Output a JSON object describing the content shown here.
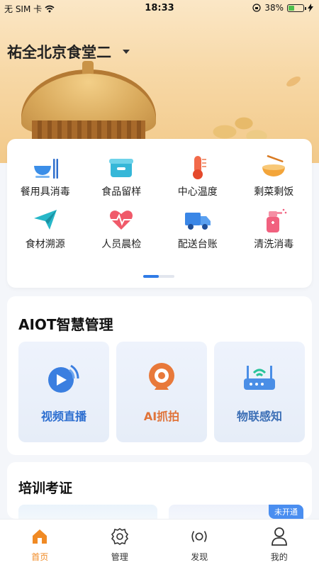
{
  "status_bar": {
    "carrier": "无 SIM 卡",
    "time": "18:33",
    "battery": "38%",
    "battery_level": 0.38
  },
  "header": {
    "canteen_name": "祐全北京食堂二"
  },
  "functions": [
    {
      "label": "餐用具消毒",
      "icon": "tableware-icon"
    },
    {
      "label": "食品留样",
      "icon": "sample-box-icon"
    },
    {
      "label": "中心温度",
      "icon": "thermometer-icon"
    },
    {
      "label": "剩菜剩饭",
      "icon": "leftover-bowl-icon"
    },
    {
      "label": "食材溯源",
      "icon": "paper-plane-icon"
    },
    {
      "label": "人员晨检",
      "icon": "heartbeat-icon"
    },
    {
      "label": "配送台账",
      "icon": "truck-icon"
    },
    {
      "label": "清洗消毒",
      "icon": "spray-bottle-icon"
    }
  ],
  "aiot": {
    "title": "AIOT智慧管理",
    "tiles": [
      {
        "label": "视频直播",
        "icon": "video-live-icon",
        "color": "#2e6fd0"
      },
      {
        "label": "AI抓拍",
        "icon": "webcam-icon",
        "color": "#e0743a"
      },
      {
        "label": "物联感知",
        "icon": "router-icon",
        "color": "#3c6fb6"
      }
    ]
  },
  "training": {
    "title": "培训考证",
    "badge": "未开通"
  },
  "tabs": [
    {
      "label": "首页",
      "icon": "home-icon",
      "active": true
    },
    {
      "label": "管理",
      "icon": "gear-icon",
      "active": false
    },
    {
      "label": "发现",
      "icon": "broadcast-icon",
      "active": false
    },
    {
      "label": "我的",
      "icon": "user-icon",
      "active": false
    }
  ],
  "colors": {
    "accent": "#f08a24",
    "primary_blue": "#2f7be6"
  }
}
